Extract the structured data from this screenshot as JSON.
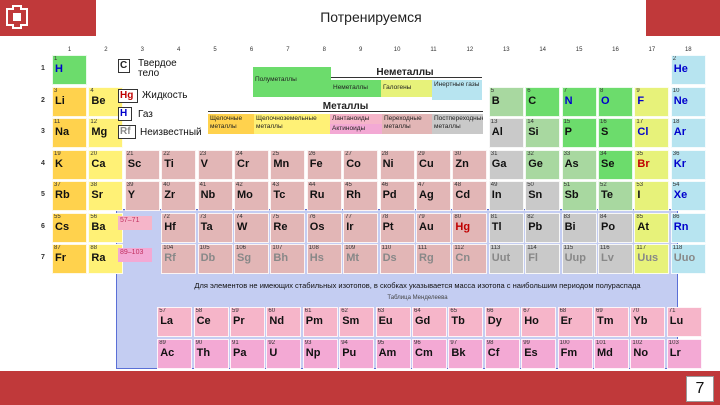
{
  "slide": {
    "title": "Потренируемся",
    "page_number": "7"
  },
  "colors": {
    "bar": "#c0393a",
    "alkali": "#ffd24d",
    "alkaline": "#fff176",
    "transition": "#e2b6b6",
    "post": "#c9c9c9",
    "metalloid": "#a8d8a0",
    "nonmetal": "#6cdc6c",
    "halogen": "#e7f27a",
    "noble": "#b7e4f0",
    "lanthanide": "#f6b5c9",
    "actinide": "#f3a9d4",
    "lanact": "#f0a0b8",
    "frame": "#c4cdf2"
  },
  "groups": [
    "1",
    "2",
    "3",
    "4",
    "5",
    "6",
    "7",
    "8",
    "9",
    "10",
    "11",
    "12",
    "13",
    "14",
    "15",
    "16",
    "17",
    "18"
  ],
  "periods": [
    "1",
    "2",
    "3",
    "4",
    "5",
    "6",
    "7"
  ],
  "legend": {
    "solid_symbol": "C",
    "solid_label": "Твердое тело",
    "liquid_symbol": "Hg",
    "liquid_label": "Жидкость",
    "gas_symbol": "H",
    "gas_label": "Газ",
    "unknown_symbol": "Rf",
    "unknown_label": "Неизвестный"
  },
  "categories": {
    "nonmetals": "Неметаллы",
    "metals": "Металлы",
    "semimetals": "Полуметаллы",
    "other_nonmetals": "Неметаллы",
    "halogens": "Галогены",
    "noble_gases": "Инертные газы",
    "alkali": "Щелочные металлы",
    "alkaline_earth": "Щелочноземельные металлы",
    "lanthanides": "Лантаноиды",
    "actinides": "Актиноиды",
    "transition": "Переходные металлы",
    "post_transition": "Постпереходные металлы",
    "lanthanide_range": "57–71",
    "actinide_range": "89–103"
  },
  "notes": {
    "line1": "Для элементов не имеющих стабильных изотопов, в скобках указывается масса изотопа с наибольшим периодом полураспада",
    "line2": "Таблица Менделеева"
  },
  "elements": [
    {
      "s": "H",
      "n": "1",
      "c": "nonmetal",
      "g": 1,
      "p": 1,
      "sc": "blue"
    },
    {
      "s": "He",
      "n": "2",
      "c": "noble",
      "g": 18,
      "p": 1,
      "sc": "blue"
    },
    {
      "s": "Li",
      "n": "3",
      "c": "alkali",
      "g": 1,
      "p": 2
    },
    {
      "s": "Be",
      "n": "4",
      "c": "alkaline",
      "g": 2,
      "p": 2
    },
    {
      "s": "B",
      "n": "5",
      "c": "metalloid",
      "g": 13,
      "p": 2
    },
    {
      "s": "C",
      "n": "6",
      "c": "nonmetal",
      "g": 14,
      "p": 2
    },
    {
      "s": "N",
      "n": "7",
      "c": "nonmetal",
      "g": 15,
      "p": 2,
      "sc": "blue"
    },
    {
      "s": "O",
      "n": "8",
      "c": "nonmetal",
      "g": 16,
      "p": 2,
      "sc": "blue"
    },
    {
      "s": "F",
      "n": "9",
      "c": "halogen",
      "g": 17,
      "p": 2,
      "sc": "blue"
    },
    {
      "s": "Ne",
      "n": "10",
      "c": "noble",
      "g": 18,
      "p": 2,
      "sc": "blue"
    },
    {
      "s": "Na",
      "n": "11",
      "c": "alkali",
      "g": 1,
      "p": 3
    },
    {
      "s": "Mg",
      "n": "12",
      "c": "alkaline",
      "g": 2,
      "p": 3
    },
    {
      "s": "Al",
      "n": "13",
      "c": "post",
      "g": 13,
      "p": 3
    },
    {
      "s": "Si",
      "n": "14",
      "c": "metalloid",
      "g": 14,
      "p": 3
    },
    {
      "s": "P",
      "n": "15",
      "c": "nonmetal",
      "g": 15,
      "p": 3
    },
    {
      "s": "S",
      "n": "16",
      "c": "nonmetal",
      "g": 16,
      "p": 3
    },
    {
      "s": "Cl",
      "n": "17",
      "c": "halogen",
      "g": 17,
      "p": 3,
      "sc": "blue"
    },
    {
      "s": "Ar",
      "n": "18",
      "c": "noble",
      "g": 18,
      "p": 3,
      "sc": "blue"
    },
    {
      "s": "K",
      "n": "19",
      "c": "alkali",
      "g": 1,
      "p": 4
    },
    {
      "s": "Ca",
      "n": "20",
      "c": "alkaline",
      "g": 2,
      "p": 4
    },
    {
      "s": "Sc",
      "n": "21",
      "c": "transition",
      "g": 3,
      "p": 4
    },
    {
      "s": "Ti",
      "n": "22",
      "c": "transition",
      "g": 4,
      "p": 4
    },
    {
      "s": "V",
      "n": "23",
      "c": "transition",
      "g": 5,
      "p": 4
    },
    {
      "s": "Cr",
      "n": "24",
      "c": "transition",
      "g": 6,
      "p": 4
    },
    {
      "s": "Mn",
      "n": "25",
      "c": "transition",
      "g": 7,
      "p": 4
    },
    {
      "s": "Fe",
      "n": "26",
      "c": "transition",
      "g": 8,
      "p": 4
    },
    {
      "s": "Co",
      "n": "27",
      "c": "transition",
      "g": 9,
      "p": 4
    },
    {
      "s": "Ni",
      "n": "28",
      "c": "transition",
      "g": 10,
      "p": 4
    },
    {
      "s": "Cu",
      "n": "29",
      "c": "transition",
      "g": 11,
      "p": 4
    },
    {
      "s": "Zn",
      "n": "30",
      "c": "transition",
      "g": 12,
      "p": 4
    },
    {
      "s": "Ga",
      "n": "31",
      "c": "post",
      "g": 13,
      "p": 4
    },
    {
      "s": "Ge",
      "n": "32",
      "c": "metalloid",
      "g": 14,
      "p": 4
    },
    {
      "s": "As",
      "n": "33",
      "c": "metalloid",
      "g": 15,
      "p": 4
    },
    {
      "s": "Se",
      "n": "34",
      "c": "nonmetal",
      "g": 16,
      "p": 4
    },
    {
      "s": "Br",
      "n": "35",
      "c": "halogen",
      "g": 17,
      "p": 4,
      "sc": "red"
    },
    {
      "s": "Kr",
      "n": "36",
      "c": "noble",
      "g": 18,
      "p": 4,
      "sc": "blue"
    },
    {
      "s": "Rb",
      "n": "37",
      "c": "alkali",
      "g": 1,
      "p": 5
    },
    {
      "s": "Sr",
      "n": "38",
      "c": "alkaline",
      "g": 2,
      "p": 5
    },
    {
      "s": "Y",
      "n": "39",
      "c": "transition",
      "g": 3,
      "p": 5
    },
    {
      "s": "Zr",
      "n": "40",
      "c": "transition",
      "g": 4,
      "p": 5
    },
    {
      "s": "Nb",
      "n": "41",
      "c": "transition",
      "g": 5,
      "p": 5
    },
    {
      "s": "Mo",
      "n": "42",
      "c": "transition",
      "g": 6,
      "p": 5
    },
    {
      "s": "Tc",
      "n": "43",
      "c": "transition",
      "g": 7,
      "p": 5
    },
    {
      "s": "Ru",
      "n": "44",
      "c": "transition",
      "g": 8,
      "p": 5
    },
    {
      "s": "Rh",
      "n": "45",
      "c": "transition",
      "g": 9,
      "p": 5
    },
    {
      "s": "Pd",
      "n": "46",
      "c": "transition",
      "g": 10,
      "p": 5
    },
    {
      "s": "Ag",
      "n": "47",
      "c": "transition",
      "g": 11,
      "p": 5
    },
    {
      "s": "Cd",
      "n": "48",
      "c": "transition",
      "g": 12,
      "p": 5
    },
    {
      "s": "In",
      "n": "49",
      "c": "post",
      "g": 13,
      "p": 5
    },
    {
      "s": "Sn",
      "n": "50",
      "c": "post",
      "g": 14,
      "p": 5
    },
    {
      "s": "Sb",
      "n": "51",
      "c": "metalloid",
      "g": 15,
      "p": 5
    },
    {
      "s": "Te",
      "n": "52",
      "c": "metalloid",
      "g": 16,
      "p": 5
    },
    {
      "s": "I",
      "n": "53",
      "c": "halogen",
      "g": 17,
      "p": 5
    },
    {
      "s": "Xe",
      "n": "54",
      "c": "noble",
      "g": 18,
      "p": 5,
      "sc": "blue"
    },
    {
      "s": "Cs",
      "n": "55",
      "c": "alkali",
      "g": 1,
      "p": 6
    },
    {
      "s": "Ba",
      "n": "56",
      "c": "alkaline",
      "g": 2,
      "p": 6
    },
    {
      "s": "Hf",
      "n": "72",
      "c": "transition",
      "g": 4,
      "p": 6
    },
    {
      "s": "Ta",
      "n": "73",
      "c": "transition",
      "g": 5,
      "p": 6
    },
    {
      "s": "W",
      "n": "74",
      "c": "transition",
      "g": 6,
      "p": 6
    },
    {
      "s": "Re",
      "n": "75",
      "c": "transition",
      "g": 7,
      "p": 6
    },
    {
      "s": "Os",
      "n": "76",
      "c": "transition",
      "g": 8,
      "p": 6
    },
    {
      "s": "Ir",
      "n": "77",
      "c": "transition",
      "g": 9,
      "p": 6
    },
    {
      "s": "Pt",
      "n": "78",
      "c": "transition",
      "g": 10,
      "p": 6
    },
    {
      "s": "Au",
      "n": "79",
      "c": "transition",
      "g": 11,
      "p": 6
    },
    {
      "s": "Hg",
      "n": "80",
      "c": "transition",
      "g": 12,
      "p": 6,
      "sc": "red"
    },
    {
      "s": "Tl",
      "n": "81",
      "c": "post",
      "g": 13,
      "p": 6
    },
    {
      "s": "Pb",
      "n": "82",
      "c": "post",
      "g": 14,
      "p": 6
    },
    {
      "s": "Bi",
      "n": "83",
      "c": "post",
      "g": 15,
      "p": 6
    },
    {
      "s": "Po",
      "n": "84",
      "c": "post",
      "g": 16,
      "p": 6
    },
    {
      "s": "At",
      "n": "85",
      "c": "halogen",
      "g": 17,
      "p": 6
    },
    {
      "s": "Rn",
      "n": "86",
      "c": "noble",
      "g": 18,
      "p": 6,
      "sc": "blue"
    },
    {
      "s": "Fr",
      "n": "87",
      "c": "alkali",
      "g": 1,
      "p": 7
    },
    {
      "s": "Ra",
      "n": "88",
      "c": "alkaline",
      "g": 2,
      "p": 7
    },
    {
      "s": "Rf",
      "n": "104",
      "c": "transition",
      "g": 4,
      "p": 7,
      "sc": "gray"
    },
    {
      "s": "Db",
      "n": "105",
      "c": "transition",
      "g": 5,
      "p": 7,
      "sc": "gray"
    },
    {
      "s": "Sg",
      "n": "106",
      "c": "transition",
      "g": 6,
      "p": 7,
      "sc": "gray"
    },
    {
      "s": "Bh",
      "n": "107",
      "c": "transition",
      "g": 7,
      "p": 7,
      "sc": "gray"
    },
    {
      "s": "Hs",
      "n": "108",
      "c": "transition",
      "g": 8,
      "p": 7,
      "sc": "gray"
    },
    {
      "s": "Mt",
      "n": "109",
      "c": "transition",
      "g": 9,
      "p": 7,
      "sc": "gray"
    },
    {
      "s": "Ds",
      "n": "110",
      "c": "transition",
      "g": 10,
      "p": 7,
      "sc": "gray"
    },
    {
      "s": "Rg",
      "n": "111",
      "c": "transition",
      "g": 11,
      "p": 7,
      "sc": "gray"
    },
    {
      "s": "Cn",
      "n": "112",
      "c": "transition",
      "g": 12,
      "p": 7,
      "sc": "gray"
    },
    {
      "s": "Uut",
      "n": "113",
      "c": "post",
      "g": 13,
      "p": 7,
      "sc": "gray"
    },
    {
      "s": "Fl",
      "n": "114",
      "c": "post",
      "g": 14,
      "p": 7,
      "sc": "gray"
    },
    {
      "s": "Uup",
      "n": "115",
      "c": "post",
      "g": 15,
      "p": 7,
      "sc": "gray"
    },
    {
      "s": "Lv",
      "n": "116",
      "c": "post",
      "g": 16,
      "p": 7,
      "sc": "gray"
    },
    {
      "s": "Uus",
      "n": "117",
      "c": "halogen",
      "g": 17,
      "p": 7,
      "sc": "gray"
    },
    {
      "s": "Uuo",
      "n": "118",
      "c": "noble",
      "g": 18,
      "p": 7,
      "sc": "gray"
    }
  ],
  "lanthanides": [
    {
      "s": "La",
      "n": "57"
    },
    {
      "s": "Ce",
      "n": "58"
    },
    {
      "s": "Pr",
      "n": "59"
    },
    {
      "s": "Nd",
      "n": "60"
    },
    {
      "s": "Pm",
      "n": "61"
    },
    {
      "s": "Sm",
      "n": "62"
    },
    {
      "s": "Eu",
      "n": "63"
    },
    {
      "s": "Gd",
      "n": "64"
    },
    {
      "s": "Tb",
      "n": "65"
    },
    {
      "s": "Dy",
      "n": "66"
    },
    {
      "s": "Ho",
      "n": "67"
    },
    {
      "s": "Er",
      "n": "68"
    },
    {
      "s": "Tm",
      "n": "69"
    },
    {
      "s": "Yb",
      "n": "70"
    },
    {
      "s": "Lu",
      "n": "71"
    }
  ],
  "actinides": [
    {
      "s": "Ac",
      "n": "89"
    },
    {
      "s": "Th",
      "n": "90"
    },
    {
      "s": "Pa",
      "n": "91"
    },
    {
      "s": "U",
      "n": "92"
    },
    {
      "s": "Np",
      "n": "93"
    },
    {
      "s": "Pu",
      "n": "94"
    },
    {
      "s": "Am",
      "n": "95"
    },
    {
      "s": "Cm",
      "n": "96"
    },
    {
      "s": "Bk",
      "n": "97"
    },
    {
      "s": "Cf",
      "n": "98"
    },
    {
      "s": "Es",
      "n": "99"
    },
    {
      "s": "Fm",
      "n": "100"
    },
    {
      "s": "Md",
      "n": "101"
    },
    {
      "s": "No",
      "n": "102"
    },
    {
      "s": "Lr",
      "n": "103"
    }
  ]
}
